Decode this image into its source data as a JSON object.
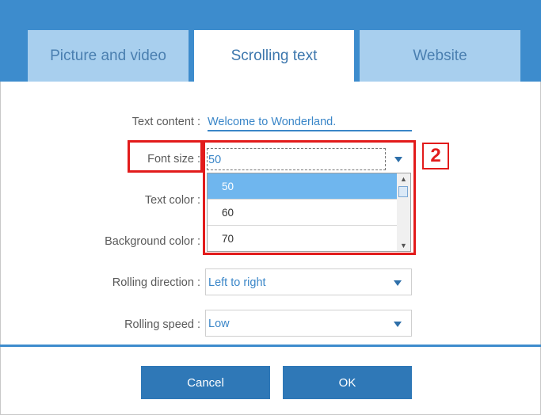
{
  "tabs": [
    {
      "label": "Picture and video",
      "active": false
    },
    {
      "label": "Scrolling text",
      "active": true
    },
    {
      "label": "Website",
      "active": false
    }
  ],
  "form": {
    "text_content": {
      "label": "Text content :",
      "value": "Welcome to Wonderland."
    },
    "font_size": {
      "label": "Font size :",
      "value": "50",
      "options": [
        "50",
        "60",
        "70"
      ],
      "highlighted_option": "50"
    },
    "text_color": {
      "label": "Text color :"
    },
    "background_color": {
      "label": "Background color :"
    },
    "rolling_direction": {
      "label": "Rolling direction :",
      "value": "Left to right"
    },
    "rolling_speed": {
      "label": "Rolling speed :",
      "value": "Low"
    }
  },
  "annotation": {
    "step_number": "2"
  },
  "buttons": {
    "cancel": "Cancel",
    "ok": "OK"
  },
  "colors": {
    "header_blue": "#3d8ccd",
    "tab_inactive": "#a8cfee",
    "accent_text": "#3a86c8",
    "button_blue": "#2f78b7",
    "highlight_red": "#e21b1b",
    "selected_option": "#6fb6ee"
  },
  "icons": {
    "dropdown_caret": "chevron-down-icon",
    "scroll_up": "scroll-up-icon",
    "scroll_down": "scroll-down-icon"
  }
}
